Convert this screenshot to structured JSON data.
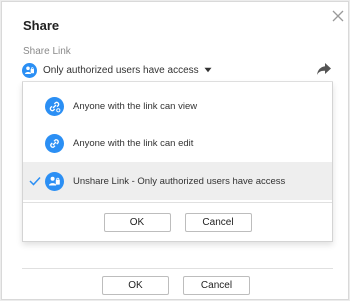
{
  "dialog": {
    "title": "Share",
    "close_icon": "close-icon"
  },
  "share_link": {
    "label": "Share Link",
    "selected_value": "Only authorized users have access",
    "badge_icon": "users-icon",
    "share_icon": "share-arrow-icon"
  },
  "menu": {
    "items": [
      {
        "label": "Anyone with the link can view",
        "icon": "link-view-icon",
        "selected": false
      },
      {
        "label": "Anyone with the link can edit",
        "icon": "link-edit-icon",
        "selected": false
      },
      {
        "label": "Unshare Link - Only authorized users have access",
        "icon": "users-icon",
        "selected": true
      }
    ],
    "ok_label": "OK",
    "cancel_label": "Cancel"
  },
  "footer": {
    "ok_label": "OK",
    "cancel_label": "Cancel"
  },
  "colors": {
    "accent": "#2b8ff4",
    "check": "#2b8ff4",
    "selected_row": "#eeeeee"
  }
}
